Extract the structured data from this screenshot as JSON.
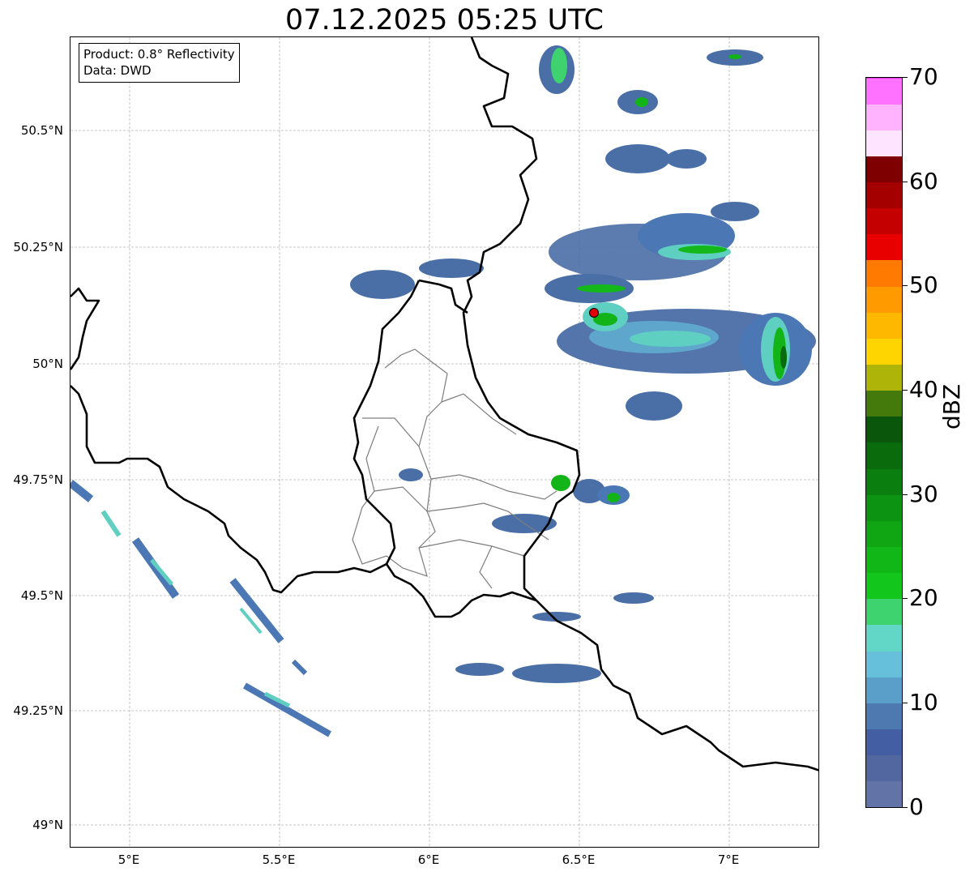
{
  "title": "07.12.2025 05:25 UTC",
  "infobox": {
    "product": "Product: 0.8° Reflectivity",
    "data": "Data: DWD"
  },
  "axes": {
    "lat_ticks": [
      "50.5°N",
      "50.25°N",
      "50°N",
      "49.75°N",
      "49.5°N",
      "49.25°N",
      "49°N"
    ],
    "lon_ticks": [
      "5°E",
      "5.5°E",
      "6°E",
      "6.5°E",
      "7°E"
    ]
  },
  "colorbar": {
    "label": "dBZ",
    "ticks": [
      "0",
      "10",
      "20",
      "30",
      "40",
      "50",
      "60",
      "70"
    ],
    "min": 0,
    "max": 70,
    "step": 2.5,
    "colors": [
      "#6273a8",
      "#52679f",
      "#435ea2",
      "#4d79b0",
      "#5a9fca",
      "#66c0dc",
      "#62d7c8",
      "#3fd36f",
      "#12c61b",
      "#10b716",
      "#0fa513",
      "#0c9311",
      "#0a7e0f",
      "#0a6b0d",
      "#0a570b",
      "#447a0c",
      "#aeb408",
      "#fed500",
      "#ffb800",
      "#ff9a00",
      "#ff7a00",
      "#e80000",
      "#c50000",
      "#a40000",
      "#7f0000",
      "#ffe4ff",
      "#ffb3ff",
      "#ff72ff",
      "#e833e8"
    ]
  },
  "map": {
    "lon_range": [
      4.8,
      7.3
    ],
    "lat_range": [
      48.95,
      50.7
    ],
    "gridlines": true,
    "radar_site": {
      "lon": 6.55,
      "lat": 50.11,
      "color": "#e00000"
    }
  }
}
